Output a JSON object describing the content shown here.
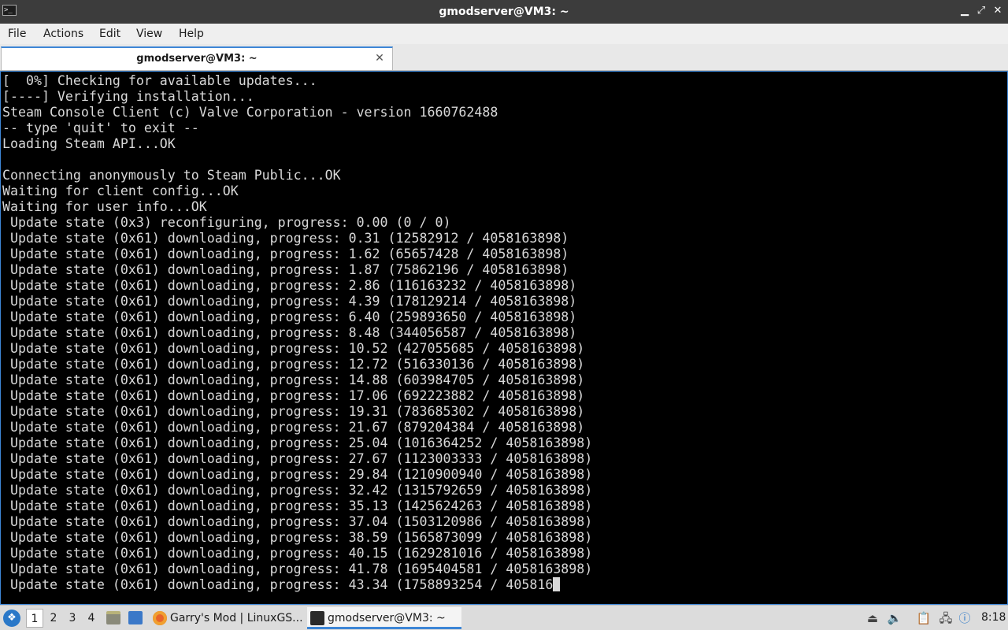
{
  "window": {
    "title": "gmodserver@VM3: ~",
    "icon": "terminal-icon",
    "controls": {
      "minimize": "▁",
      "maximize": "⤢",
      "close": "✕"
    }
  },
  "menubar": {
    "items": [
      "File",
      "Actions",
      "Edit",
      "View",
      "Help"
    ]
  },
  "tabs": [
    {
      "label": "gmodserver@VM3: ~",
      "close": "✕"
    }
  ],
  "terminal": {
    "lines": [
      "[  0%] Checking for available updates...",
      "[----] Verifying installation...",
      "Steam Console Client (c) Valve Corporation - version 1660762488",
      "-- type 'quit' to exit --",
      "Loading Steam API...OK",
      "",
      "Connecting anonymously to Steam Public...OK",
      "Waiting for client config...OK",
      "Waiting for user info...OK",
      " Update state (0x3) reconfiguring, progress: 0.00 (0 / 0)",
      " Update state (0x61) downloading, progress: 0.31 (12582912 / 4058163898)",
      " Update state (0x61) downloading, progress: 1.62 (65657428 / 4058163898)",
      " Update state (0x61) downloading, progress: 1.87 (75862196 / 4058163898)",
      " Update state (0x61) downloading, progress: 2.86 (116163232 / 4058163898)",
      " Update state (0x61) downloading, progress: 4.39 (178129214 / 4058163898)",
      " Update state (0x61) downloading, progress: 6.40 (259893650 / 4058163898)",
      " Update state (0x61) downloading, progress: 8.48 (344056587 / 4058163898)",
      " Update state (0x61) downloading, progress: 10.52 (427055685 / 4058163898)",
      " Update state (0x61) downloading, progress: 12.72 (516330136 / 4058163898)",
      " Update state (0x61) downloading, progress: 14.88 (603984705 / 4058163898)",
      " Update state (0x61) downloading, progress: 17.06 (692223882 / 4058163898)",
      " Update state (0x61) downloading, progress: 19.31 (783685302 / 4058163898)",
      " Update state (0x61) downloading, progress: 21.67 (879204384 / 4058163898)",
      " Update state (0x61) downloading, progress: 25.04 (1016364252 / 4058163898)",
      " Update state (0x61) downloading, progress: 27.67 (1123003333 / 4058163898)",
      " Update state (0x61) downloading, progress: 29.84 (1210900940 / 4058163898)",
      " Update state (0x61) downloading, progress: 32.42 (1315792659 / 4058163898)",
      " Update state (0x61) downloading, progress: 35.13 (1425624263 / 4058163898)",
      " Update state (0x61) downloading, progress: 37.04 (1503120986 / 4058163898)",
      " Update state (0x61) downloading, progress: 38.59 (1565873099 / 4058163898)",
      " Update state (0x61) downloading, progress: 40.15 (1629281016 / 4058163898)",
      " Update state (0x61) downloading, progress: 41.78 (1695404581 / 4058163898)"
    ],
    "last_line": " Update state (0x61) downloading, progress: 43.34 (1758893254 / 405816",
    "colors": {
      "background": "#000000",
      "foreground": "#d8d8d8"
    }
  },
  "taskbar": {
    "start_icon": "lxqt-start-icon",
    "start_glyph": "❖",
    "desktops": [
      "1",
      "2",
      "3",
      "4"
    ],
    "active_desktop": "1",
    "quicklaunch": [
      "file-manager-icon",
      "show-desktop-icon"
    ],
    "tasks": [
      {
        "label": "Garry's Mod | LinuxGS...",
        "icon": "firefox-icon"
      },
      {
        "label": "gmodserver@VM3: ~",
        "icon": "terminal-icon"
      }
    ],
    "tray": {
      "icons": [
        "removable-media-icon",
        "volume-icon",
        "clipboard-icon",
        "network-icon",
        "update-notifier-icon"
      ],
      "clock": "8:18"
    }
  }
}
